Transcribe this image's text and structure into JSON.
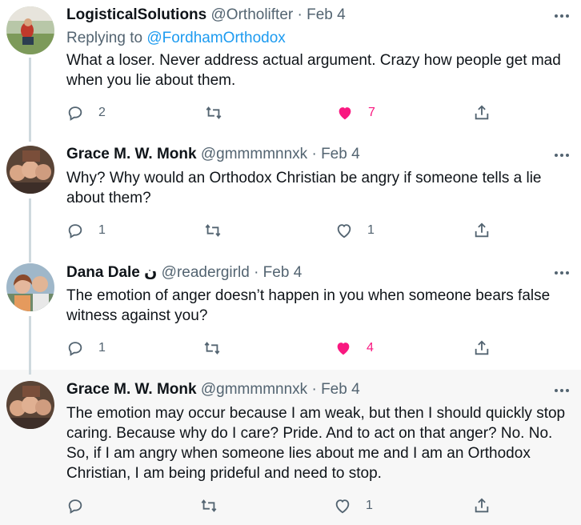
{
  "tweets": [
    {
      "name": "LogisticalSolutions",
      "handle": "@Ortholifter",
      "separator": "·",
      "date": "Feb 4",
      "replying_prefix": "Replying to",
      "replying_to": "@FordhamOrthodox",
      "text": "What a loser.  Never address actual argument.  Crazy how people get mad when you lie about them.",
      "replies": "2",
      "retweets": "",
      "likes": "7",
      "liked": true
    },
    {
      "name": "Grace M. W. Monk",
      "handle": "@gmmmmnnxk",
      "separator": "·",
      "date": "Feb 4",
      "text": "Why? Why would an Orthodox Christian be angry if someone tells a lie about them?",
      "replies": "1",
      "retweets": "",
      "likes": "1",
      "liked": false
    },
    {
      "name": "Dana Dale ن",
      "handle": "@readergirld",
      "separator": "·",
      "date": "Feb 4",
      "text": "The emotion of anger doesn’t happen in you when someone bears false witness against you?",
      "replies": "1",
      "retweets": "",
      "likes": "4",
      "liked": true
    },
    {
      "name": "Grace M. W. Monk",
      "handle": "@gmmmmnnxk",
      "separator": "·",
      "date": "Feb 4",
      "text": "The emotion may occur because I am weak, but then I should quickly stop caring. Because why do I care? Pride. And to act on that anger? No. No. So, if I am angry when someone lies about me and I am an Orthodox Christian, I am being prideful and need to stop.",
      "replies": "",
      "retweets": "",
      "likes": "1",
      "liked": false
    }
  ],
  "colors": {
    "like": "#f91880",
    "link": "#1d9bf0",
    "muted": "#536471",
    "thread_line": "#cfd9de",
    "highlight_bg": "#f7f7f7"
  },
  "icons": {
    "more": "more-icon",
    "reply": "reply-icon",
    "retweet": "retweet-icon",
    "like": "heart-icon",
    "share": "share-icon"
  }
}
